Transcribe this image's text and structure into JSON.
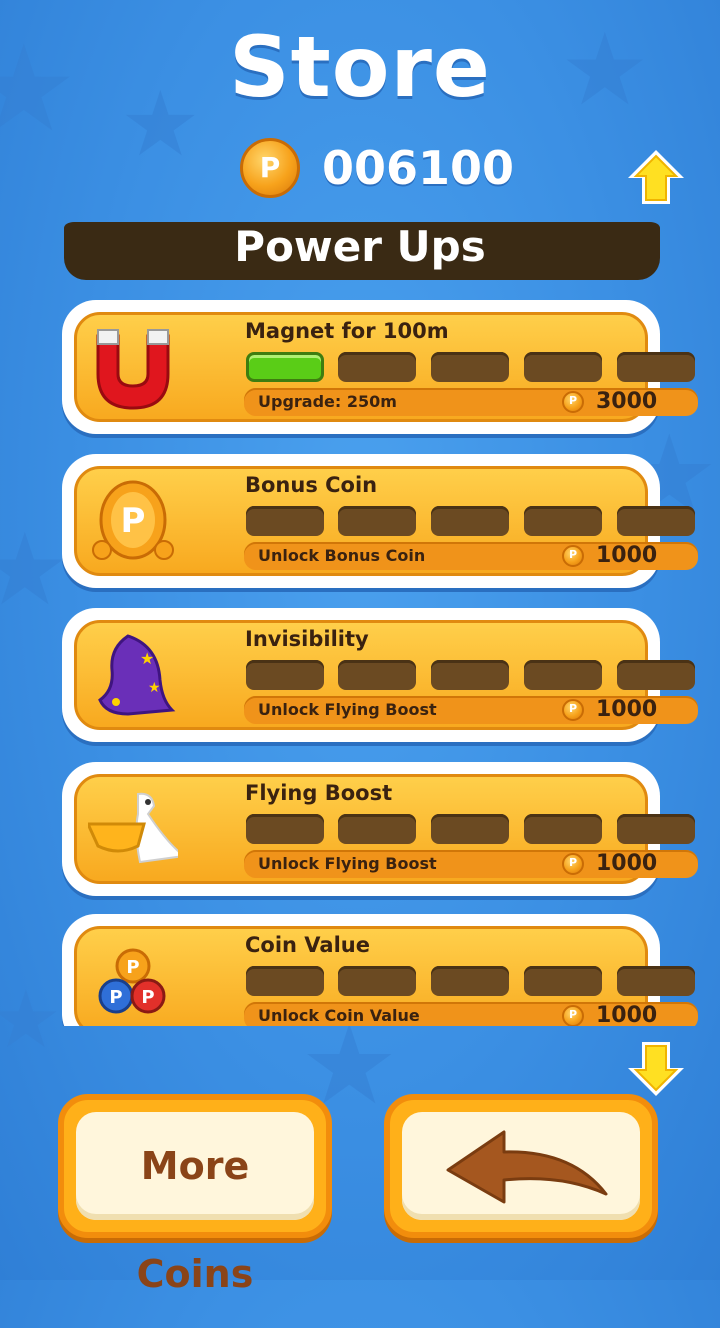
{
  "header": {
    "title": "Store",
    "coin_balance": "006100",
    "coin_symbol": "P"
  },
  "section": {
    "title": "Power Ups"
  },
  "powerups": [
    {
      "name": "Magnet for 100m",
      "icon": "magnet-icon",
      "level": 1,
      "max_level": 5,
      "info": "Upgrade: 250m",
      "price": "3000"
    },
    {
      "name": "Bonus Coin",
      "icon": "bonus-coin-icon",
      "level": 0,
      "max_level": 5,
      "info": "Unlock Bonus Coin",
      "price": "1000"
    },
    {
      "name": "Invisibility",
      "icon": "wizard-hood-icon",
      "level": 0,
      "max_level": 5,
      "info": "Unlock Flying Boost",
      "price": "1000"
    },
    {
      "name": "Flying Boost",
      "icon": "pelican-icon",
      "level": 0,
      "max_level": 5,
      "info": "Unlock Flying Boost",
      "price": "1000"
    },
    {
      "name": "Coin Value",
      "icon": "coin-stack-icon",
      "level": 0,
      "max_level": 5,
      "info": "Unlock Coin Value",
      "price": "1000"
    }
  ],
  "buttons": {
    "more_coins": "More Coins",
    "back_icon": "back-arrow-icon"
  },
  "colors": {
    "background": "#3b8fe3",
    "card_fill": "#f8a91f",
    "level_filled": "#5acd17",
    "level_empty": "#6b4a22",
    "text_dark": "#3a2210"
  }
}
